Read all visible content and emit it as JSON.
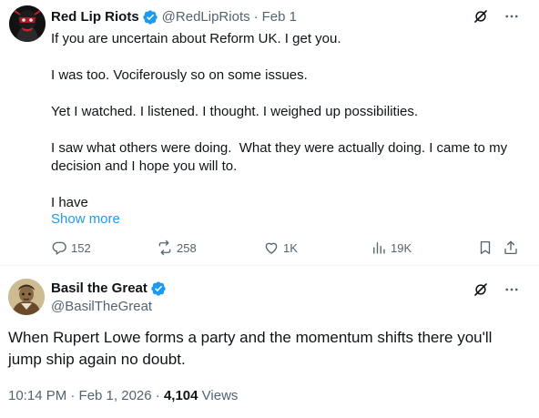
{
  "tweet1": {
    "author_name": "Red Lip Riots",
    "handle": "@RedLipRiots",
    "separator": "·",
    "date": "Feb 1",
    "paragraphs": [
      "If you are uncertain about Reform UK. I get you.",
      "I was too. Vociferously so on some issues.",
      "Yet I watched. I listened. I thought. I weighed up possibilities.",
      "I saw what others were doing.  What they were actually doing. I came to my decision and I hope you will to.",
      "I have"
    ],
    "show_more": "Show more",
    "actions": {
      "replies": "152",
      "reposts": "258",
      "likes": "1K",
      "views": "19K"
    }
  },
  "tweet2": {
    "author_name": "Basil the Great",
    "handle": "@BasilTheGreat",
    "text": "When Rupert Lowe forms a party and the momentum shifts there you'll jump ship again no doubt.",
    "timestamp": "10:14 PM · Feb 1, 2026",
    "meta_separator": "·",
    "views_count": "4,104",
    "views_label": "Views"
  },
  "colors": {
    "verified": "#1d9bf0",
    "link": "#1d9bf0",
    "secondary_text": "#536471",
    "primary_text": "#0f1419"
  },
  "icons": [
    "avatar-red-lip",
    "verified-badge",
    "grok-icon",
    "more-icon",
    "reply-icon",
    "repost-icon",
    "like-icon",
    "views-icon",
    "bookmark-icon",
    "share-icon",
    "avatar-basil"
  ]
}
